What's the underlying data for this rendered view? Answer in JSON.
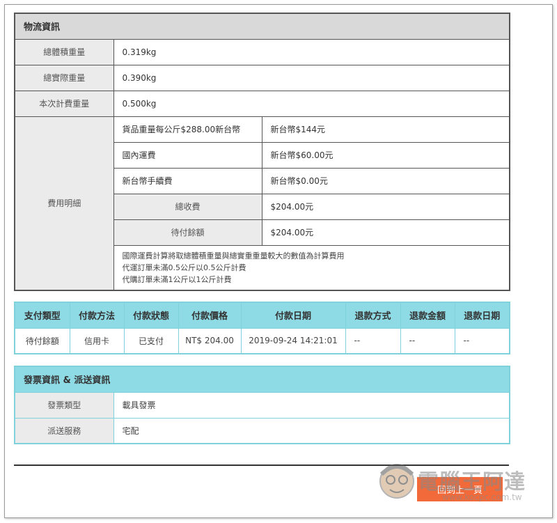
{
  "logistics": {
    "title": "物流資訊",
    "rows": [
      {
        "label": "總體積重量",
        "value": "0.319kg"
      },
      {
        "label": "總實際重量",
        "value": "0.390kg"
      },
      {
        "label": "本次計費重量",
        "value": "0.500kg"
      }
    ],
    "fees": {
      "label": "費用明細",
      "items": [
        {
          "label": "貨品重量每公斤$288.00新台幣",
          "value": "新台幣$144元"
        },
        {
          "label": "國內運費",
          "value": "新台幣$60.00元"
        },
        {
          "label": "新台幣手續費",
          "value": "新台幣$0.00元"
        }
      ],
      "total_label": "總收費",
      "total_value": "$204.00元",
      "pending_label": "待付餘額",
      "pending_value": "$204.00元",
      "notes": [
        "國際運費計算將取總體積重量與總實重重量較大的數值為計算費用",
        "代運訂單未滿0.5公斤以0.5公斤計費",
        "代購訂單未滿1公斤以1公斤計費"
      ]
    }
  },
  "payment": {
    "headers": [
      "支付類型",
      "付款方法",
      "付款狀態",
      "付款價格",
      "付款日期",
      "退款方式",
      "退款金額",
      "退款日期"
    ],
    "row": [
      "待付餘額",
      "信用卡",
      "已支付",
      "NT$ 204.00",
      "2019-09-24 14:21:01",
      "--",
      "--",
      "--"
    ]
  },
  "invoice": {
    "title": "發票資訊 & 派送資訊",
    "rows": [
      {
        "label": "發票類型",
        "value": "載具發票"
      },
      {
        "label": "派送服務",
        "value": "宅配"
      }
    ]
  },
  "back_button": "回到上一頁",
  "watermark": {
    "text": "電腦王阿達",
    "url": "www.kocpc.com.tw"
  },
  "colors": {
    "accent": "#f26a3a",
    "teal_header": "#8fdbe5",
    "teal_border": "#7fd1dc",
    "gray_header": "#d9d9d9"
  }
}
